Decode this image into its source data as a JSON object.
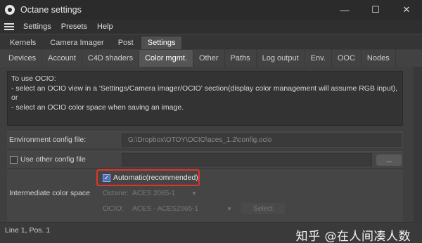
{
  "window": {
    "title": "Octane settings",
    "controls": {
      "minimize": "—",
      "maximize": "☐",
      "close": "✕"
    }
  },
  "menubar": {
    "items": [
      "Settings",
      "Presets",
      "Help"
    ]
  },
  "main_tabs": [
    {
      "label": "Kernels",
      "active": false
    },
    {
      "label": "Camera Imager",
      "active": false
    },
    {
      "label": "Post",
      "active": false
    },
    {
      "label": "Settings",
      "active": true
    }
  ],
  "sub_tabs": [
    {
      "label": "Devices",
      "active": false
    },
    {
      "label": "Account",
      "active": false
    },
    {
      "label": "C4D shaders",
      "active": false
    },
    {
      "label": "Color mgmt.",
      "active": true
    },
    {
      "label": "Other",
      "active": false
    },
    {
      "label": "Paths",
      "active": false
    },
    {
      "label": "Log output",
      "active": false
    },
    {
      "label": "Env.",
      "active": false
    },
    {
      "label": "OOC",
      "active": false
    },
    {
      "label": "Nodes",
      "active": false
    }
  ],
  "info": {
    "lines": [
      "To use OCIO:",
      "- select an OCIO view in a 'Settings/Camera imager/OCIO' section(display color management will assume RGB input), or",
      "- select an OCIO color space when saving an image."
    ]
  },
  "environment": {
    "label": "Environment config file:",
    "value": "G:\\Dropbox\\OTOY\\OCIO\\aces_1.2\\config.ocio"
  },
  "other_config": {
    "label": "Use other config file",
    "checked": false,
    "browse_label": "..."
  },
  "intermediate": {
    "label": "Intermediate color space",
    "automatic_label": "Automatic(recommended)",
    "automatic_checked": true,
    "octane_label": "Octane:",
    "octane_value": "ACES 2065-1",
    "ocio_label": "OCIO:",
    "ocio_value": "ACES - ACES2065-1",
    "select_label": "Select"
  },
  "status": {
    "position": "Line 1, Pos. 1"
  },
  "watermark": "知乎 @在人间凑人数",
  "colors": {
    "highlight": "#e0352b",
    "checkbox_accent": "#4a6fc0"
  }
}
